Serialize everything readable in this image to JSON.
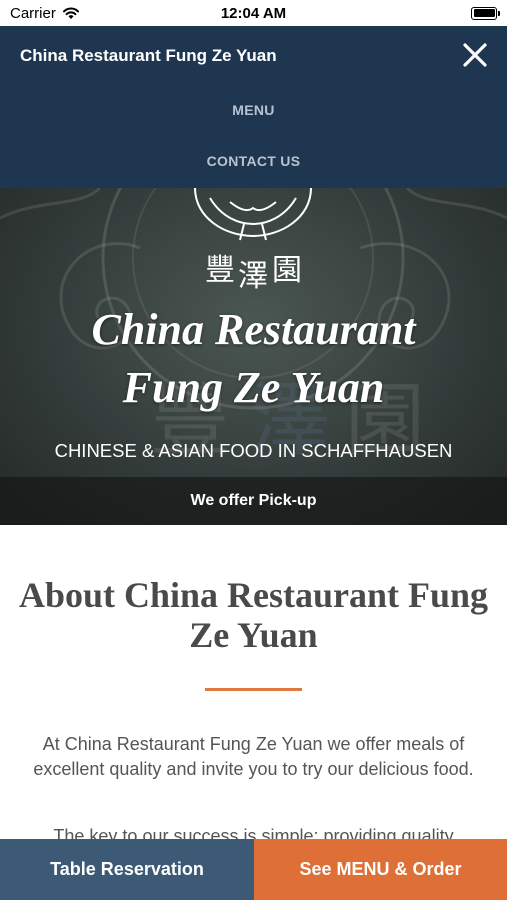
{
  "status_bar": {
    "carrier": "Carrier",
    "time": "12:04 AM"
  },
  "nav": {
    "title": "China Restaurant Fung Ze Yuan",
    "links": [
      "MENU",
      "CONTACT US"
    ],
    "close_icon": "close-icon",
    "background": "#1f3650"
  },
  "hero": {
    "logo_glyphs": [
      "豐",
      "澤",
      "園"
    ],
    "title_line1": "China Restaurant",
    "title_line2": "Fung Ze Yuan",
    "subtitle": "CHINESE & ASIAN FOOD IN SCHAFFHAUSEN",
    "pickup_text": "We offer Pick-up"
  },
  "about": {
    "heading": "About China Restaurant Fung Ze Yuan",
    "paragraph1": "At China Restaurant Fung Ze Yuan we offer meals of excellent quality and invite you to try our delicious food.",
    "paragraph2": "The key to our success is simple: providing quality",
    "accent_color": "#e0793f"
  },
  "actions": {
    "reserve_label": "Table Reservation",
    "order_label": "See MENU & Order",
    "reserve_color": "#3c5a76",
    "order_color": "#dd6f37"
  }
}
